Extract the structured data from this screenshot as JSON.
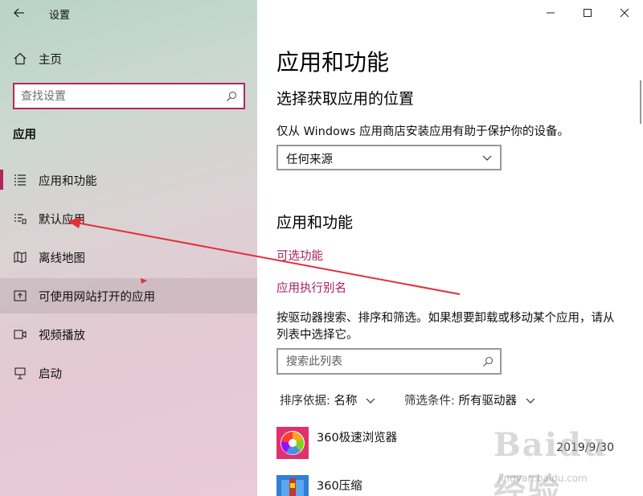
{
  "window": {
    "title": "设置"
  },
  "sidebar": {
    "home_label": "主页",
    "search_placeholder": "查找设置",
    "section_title": "应用",
    "items": [
      {
        "label": "应用和功能",
        "icon": "apps-list-icon"
      },
      {
        "label": "默认应用",
        "icon": "default-apps-icon"
      },
      {
        "label": "离线地图",
        "icon": "map-icon"
      },
      {
        "label": "可使用网站打开的应用",
        "icon": "open-website-icon"
      },
      {
        "label": "视频播放",
        "icon": "video-icon"
      },
      {
        "label": "启动",
        "icon": "startup-icon"
      }
    ]
  },
  "main": {
    "title": "应用和功能",
    "install_section": {
      "title": "选择获取应用的位置",
      "description": "仅从 Windows 应用商店安装应用有助于保护你的设备。",
      "dropdown_value": "任何来源"
    },
    "apps_section": {
      "title": "应用和功能",
      "links": [
        "可选功能",
        "应用执行别名"
      ],
      "description": "按驱动器搜索、排序和筛选。如果想要卸载或移动某个应用，请从列表中选择它。",
      "search_placeholder": "搜索此列表",
      "sort_label": "排序依据:",
      "sort_value": "名称",
      "filter_label": "筛选条件:",
      "filter_value": "所有驱动器",
      "apps": [
        {
          "name": "360极速浏览器",
          "date": "2019/9/30",
          "icon": "browser-360-icon"
        },
        {
          "name": "360压缩",
          "date": "",
          "icon": "zip-360-icon"
        }
      ]
    }
  },
  "watermark": {
    "text": "Baidu经验",
    "url": "jingyan.baidu.com"
  },
  "colors": {
    "accent": "#b2245a",
    "link": "#a7205a",
    "annotation": "#e0303a"
  }
}
